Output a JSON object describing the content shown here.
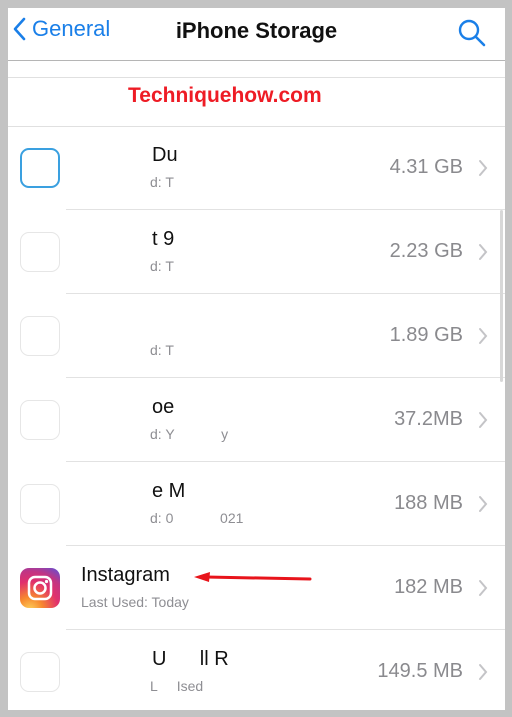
{
  "nav": {
    "back_label": "General",
    "title": "iPhone Storage",
    "search_icon": "search-icon"
  },
  "watermark": "Techniquehow.com",
  "colors": {
    "accent": "#1a7fe8",
    "watermark": "#ee1c25",
    "arrow": "#e8141b"
  },
  "apps": [
    {
      "name": "Du",
      "sub": "d: T",
      "size": "4.31 GB"
    },
    {
      "name": "t 9",
      "sub": "d: T",
      "size": "2.23 GB"
    },
    {
      "name": "",
      "sub": "d: T",
      "size": "1.89 GB"
    },
    {
      "name": "oe",
      "sub": "d: Y            y",
      "size": "37.2MB"
    },
    {
      "name": "e M",
      "sub": "d: 0            021",
      "size": "188 MB"
    },
    {
      "name": "Instagram",
      "sub": "Last Used: Today",
      "size": "182 MB"
    },
    {
      "name": "U      ll R",
      "sub": "L     Ised",
      "size": "149.5 MB"
    }
  ]
}
